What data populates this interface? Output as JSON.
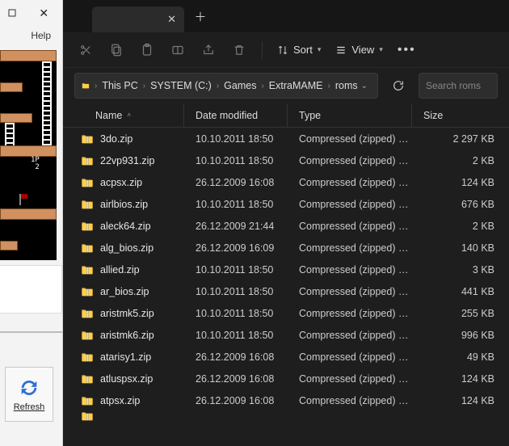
{
  "left": {
    "help_label": "Help",
    "refresh_label": "Refresh",
    "preview_text": "1P\n 2"
  },
  "toolbar": {
    "sort_label": "Sort",
    "view_label": "View"
  },
  "breadcrumbs": [
    "This PC",
    "SYSTEM (C:)",
    "Games",
    "ExtraMAME",
    "roms"
  ],
  "search_placeholder": "Search roms",
  "columns": {
    "name": "Name",
    "date": "Date modified",
    "type": "Type",
    "size": "Size"
  },
  "file_type_label": "Compressed (zipped) Folder",
  "files": [
    {
      "name": "3do.zip",
      "date": "10.10.2011 18:50",
      "size": "2 297 KB"
    },
    {
      "name": "22vp931.zip",
      "date": "10.10.2011 18:50",
      "size": "2 KB"
    },
    {
      "name": "acpsx.zip",
      "date": "26.12.2009 16:08",
      "size": "124 KB"
    },
    {
      "name": "airlbios.zip",
      "date": "10.10.2011 18:50",
      "size": "676 KB"
    },
    {
      "name": "aleck64.zip",
      "date": "26.12.2009 21:44",
      "size": "2 KB"
    },
    {
      "name": "alg_bios.zip",
      "date": "26.12.2009 16:09",
      "size": "140 KB"
    },
    {
      "name": "allied.zip",
      "date": "10.10.2011 18:50",
      "size": "3 KB"
    },
    {
      "name": "ar_bios.zip",
      "date": "10.10.2011 18:50",
      "size": "441 KB"
    },
    {
      "name": "aristmk5.zip",
      "date": "10.10.2011 18:50",
      "size": "255 KB"
    },
    {
      "name": "aristmk6.zip",
      "date": "10.10.2011 18:50",
      "size": "996 KB"
    },
    {
      "name": "atarisy1.zip",
      "date": "26.12.2009 16:08",
      "size": "49 KB"
    },
    {
      "name": "atluspsx.zip",
      "date": "26.12.2009 16:08",
      "size": "124 KB"
    },
    {
      "name": "atpsx.zip",
      "date": "26.12.2009 16:08",
      "size": "124 KB"
    }
  ]
}
